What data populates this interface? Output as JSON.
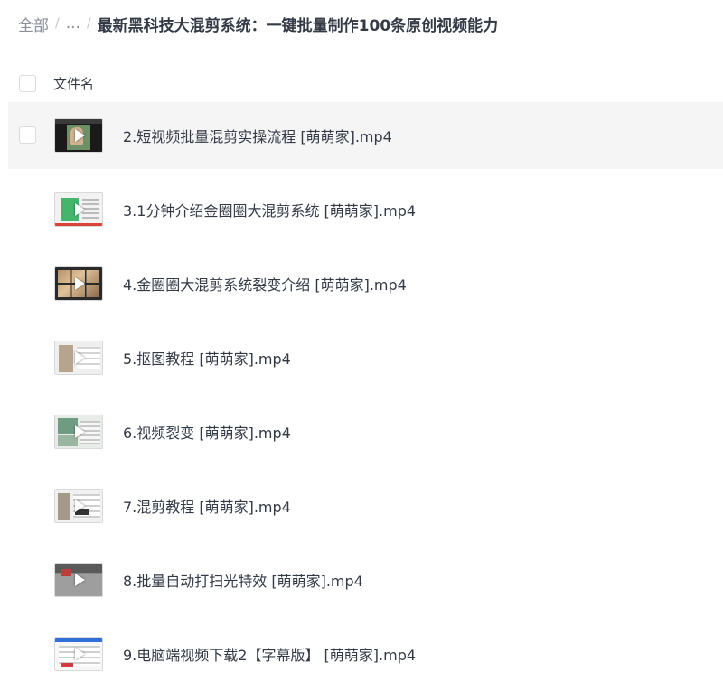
{
  "breadcrumb": {
    "root": "全部",
    "ellipsis": "...",
    "separator": "/",
    "current": "最新黑科技大混剪系统：一键批量制作100条原创视频能力"
  },
  "list_header": {
    "column_label": "文件名"
  },
  "files": [
    {
      "name": "2.短视频批量混剪实操流程 [萌萌家].mp4"
    },
    {
      "name": "3.1分钟介绍金圈圈大混剪系统 [萌萌家].mp4"
    },
    {
      "name": "4.金圈圈大混剪系统裂变介绍 [萌萌家].mp4"
    },
    {
      "name": "5.抠图教程 [萌萌家].mp4"
    },
    {
      "name": "6.视频裂变 [萌萌家].mp4"
    },
    {
      "name": "7.混剪教程 [萌萌家].mp4"
    },
    {
      "name": "8.批量自动打扫光特效 [萌萌家].mp4"
    },
    {
      "name": "9.电脑端视频下载2【字幕版】 [萌萌家].mp4"
    }
  ],
  "icons": {
    "file_thumbnail": "video-thumbnail-icon",
    "play": "play-icon",
    "checkbox": "checkbox-icon"
  },
  "colors": {
    "hover_row": "#f5f5f6",
    "text": "#333a46",
    "muted": "#8a8f99"
  }
}
